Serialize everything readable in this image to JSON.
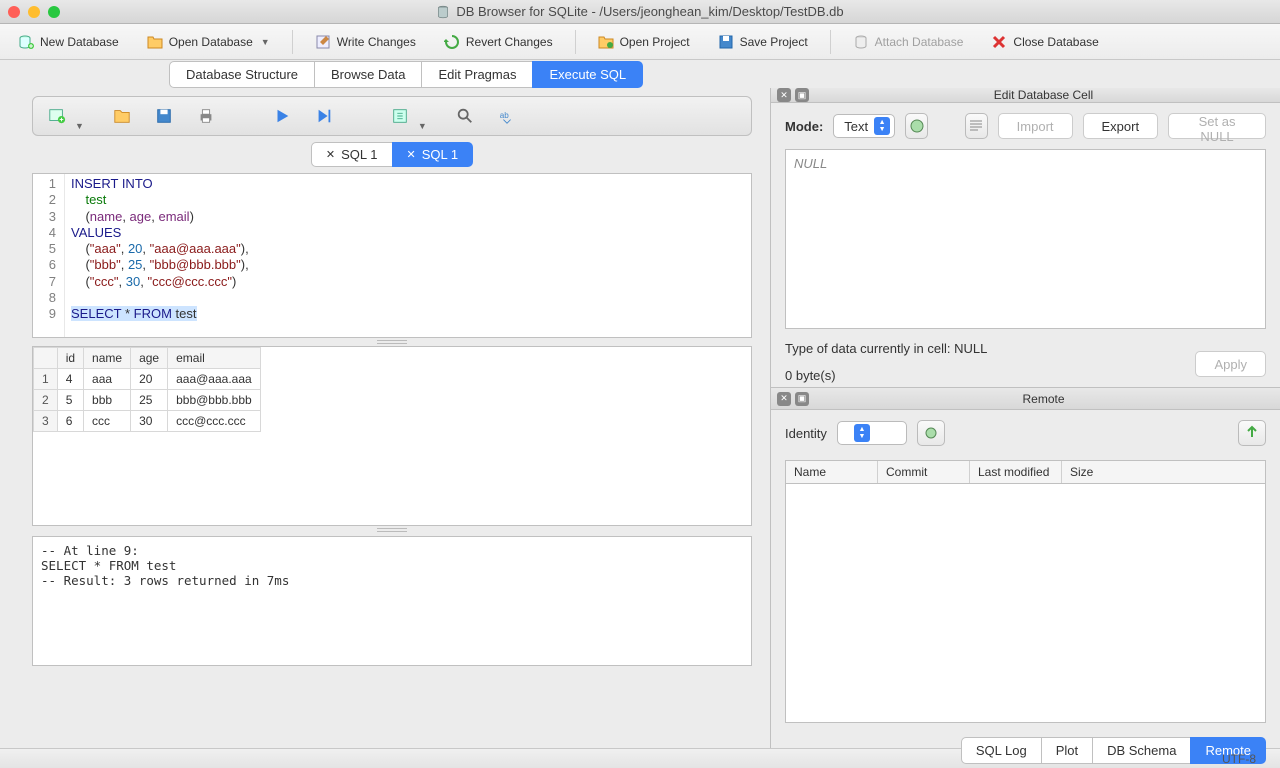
{
  "window": {
    "app_name": "DB Browser for SQLite",
    "file_path": "/Users/jeonghean_kim/Desktop/TestDB.db"
  },
  "toolbar": {
    "new_db": "New Database",
    "open_db": "Open Database",
    "write_changes": "Write Changes",
    "revert_changes": "Revert Changes",
    "open_project": "Open Project",
    "save_project": "Save Project",
    "attach_db": "Attach Database",
    "close_db": "Close Database"
  },
  "view_tabs": {
    "structure": "Database Structure",
    "browse": "Browse Data",
    "pragmas": "Edit Pragmas",
    "execute": "Execute SQL"
  },
  "sql_tabs": [
    {
      "label": "SQL 1",
      "active": false
    },
    {
      "label": "SQL 1",
      "active": true
    }
  ],
  "editor": {
    "lines": [
      "1",
      "2",
      "3",
      "4",
      "5",
      "6",
      "7",
      "8",
      "9"
    ],
    "code_html": "<span class='kw'>INSERT INTO</span>\n    <span class='id'>test</span>\n    (<span class='col'>name</span>, <span class='col'>age</span>, <span class='col'>email</span>)\n<span class='kw'>VALUES</span>\n    (<span class='str'>\"aaa\"</span>, <span class='num'>20</span>, <span class='str'>\"aaa@aaa.aaa\"</span>),\n    (<span class='str'>\"bbb\"</span>, <span class='num'>25</span>, <span class='str'>\"bbb@bbb.bbb\"</span>),\n    (<span class='str'>\"ccc\"</span>, <span class='num'>30</span>, <span class='str'>\"ccc@ccc.ccc\"</span>)\n\n<span class='sel'><span class='kw'>SELECT</span> * <span class='kw'>FROM</span> test</span>"
  },
  "result": {
    "columns": [
      "id",
      "name",
      "age",
      "email"
    ],
    "rows": [
      {
        "n": "1",
        "id": "4",
        "name": "aaa",
        "age": "20",
        "email": "aaa@aaa.aaa"
      },
      {
        "n": "2",
        "id": "5",
        "name": "bbb",
        "age": "25",
        "email": "bbb@bbb.bbb"
      },
      {
        "n": "3",
        "id": "6",
        "name": "ccc",
        "age": "30",
        "email": "ccc@ccc.ccc"
      }
    ]
  },
  "log": "-- At line 9:\nSELECT * FROM test\n-- Result: 3 rows returned in 7ms",
  "cell_panel": {
    "title": "Edit Database Cell",
    "mode_label": "Mode:",
    "mode_value": "Text",
    "import": "Import",
    "export": "Export",
    "set_null": "Set as NULL",
    "placeholder": "NULL",
    "type_info": "Type of data currently in cell: NULL",
    "size_info": "0 byte(s)",
    "apply": "Apply"
  },
  "remote_panel": {
    "title": "Remote",
    "identity_label": "Identity",
    "columns": {
      "name": "Name",
      "commit": "Commit",
      "modified": "Last modified",
      "size": "Size"
    }
  },
  "bottom_tabs": {
    "sql_log": "SQL Log",
    "plot": "Plot",
    "schema": "DB Schema",
    "remote": "Remote"
  },
  "status": {
    "encoding": "UTF-8"
  }
}
